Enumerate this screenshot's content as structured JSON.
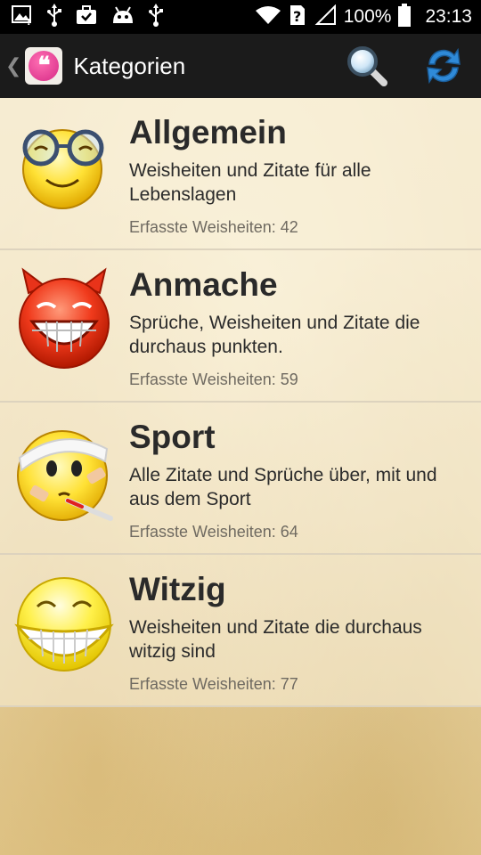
{
  "status_bar": {
    "battery": "100%",
    "time": "23:13",
    "icons": [
      "image-notification-icon",
      "usb-icon",
      "briefcase-check-icon",
      "android-icon",
      "usb-icon",
      "wifi-icon",
      "unknown-sim-icon",
      "signal-icon",
      "battery-icon"
    ]
  },
  "action_bar": {
    "title": "Kategorien",
    "back_glyph": "❮",
    "app_icon_glyph": "❝",
    "actions": [
      "search-icon",
      "refresh-icon"
    ]
  },
  "categories": [
    {
      "title": "Allgemein",
      "description": "Weisheiten und Zitate für alle Lebenslagen",
      "count": "Erfasste Weisheiten: 42",
      "icon": "smiley-glasses-icon"
    },
    {
      "title": "Anmache",
      "description": "Sprüche, Weisheiten und Zitate die durchaus punkten.",
      "count": "Erfasste Weisheiten: 59",
      "icon": "smiley-devil-icon"
    },
    {
      "title": "Sport",
      "description": "Alle Zitate und Sprüche über, mit und aus dem Sport",
      "count": "Erfasste Weisheiten: 64",
      "icon": "smiley-injured-icon"
    },
    {
      "title": "Witzig",
      "description": "Weisheiten und Zitate die durchaus witzig sind",
      "count": "Erfasste Weisheiten: 77",
      "icon": "smiley-grin-icon"
    }
  ],
  "colors": {
    "status_bar": "#000000",
    "action_bar": "#1b1b1b",
    "title_text": "#2a2a2a",
    "count_text": "#6f6a61",
    "background": "#f3e6c6"
  }
}
